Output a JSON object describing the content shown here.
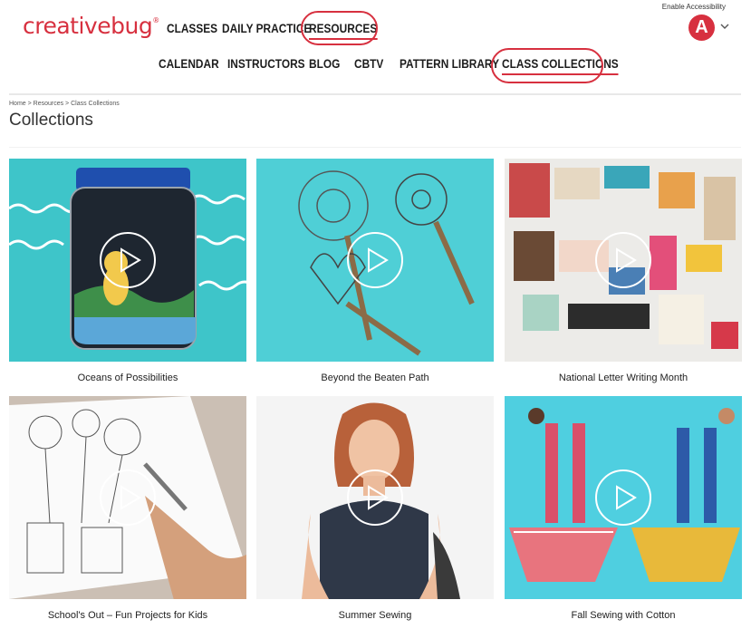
{
  "brand": {
    "name": "creativebug",
    "trademark": "®",
    "color": "#d7303f"
  },
  "nav_main": [
    "CLASSES",
    "DAILY PRACTICE",
    "RESOURCES"
  ],
  "nav_sub": [
    "CALENDAR",
    "INSTRUCTORS",
    "BLOG",
    "CBTV",
    "PATTERN LIBRARY",
    "CLASS COLLECTIONS"
  ],
  "accessibility_label": "Enable Accessibility",
  "avatar_letter": "A",
  "breadcrumb": "Home > Resources > Class Collections",
  "page_title": "Collections",
  "collections": [
    {
      "title": "Oceans of Possibilities",
      "icon": "play-icon"
    },
    {
      "title": "Beyond the Beaten Path",
      "icon": "play-icon"
    },
    {
      "title": "National Letter Writing Month",
      "icon": "play-icon"
    },
    {
      "title": "School's Out – Fun Projects for Kids",
      "icon": "play-icon"
    },
    {
      "title": "Summer Sewing",
      "icon": "play-icon"
    },
    {
      "title": "Fall Sewing with Cotton",
      "icon": "play-icon"
    }
  ],
  "colors": {
    "accent": "#d7303f",
    "teal": "#3ec5c9"
  }
}
